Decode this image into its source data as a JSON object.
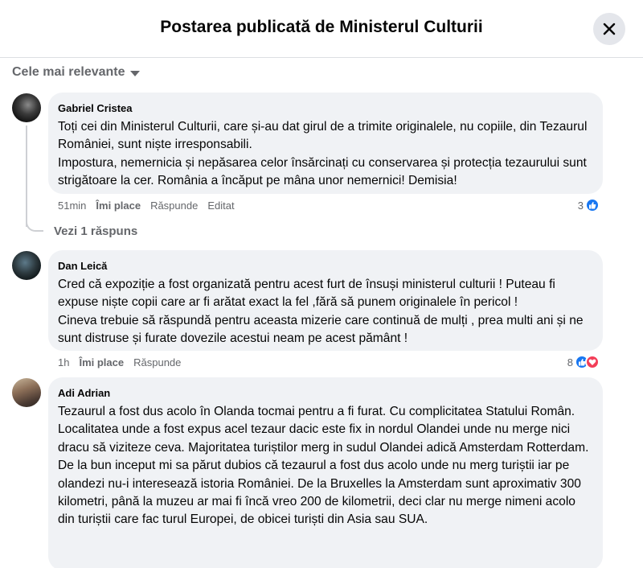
{
  "header": {
    "title": "Postarea publicată de Ministerul Culturii"
  },
  "sort": {
    "label": "Cele mai relevante"
  },
  "comments": [
    {
      "author": "Gabriel Cristea",
      "text": "Toți cei din Ministerul Culturii, care și-au dat girul de a trimite originalele, nu copiile, din Tezaurul României, sunt niște irresponsabili.\nImpostura, nemernicia și nepăsarea celor însărcinați cu conservarea și protecția tezaurului sunt strigătoare la cer. România a încăput pe mâna unor nemernici! Demisia!",
      "time": "51min",
      "like_label": "Îmi place",
      "reply_label": "Răspunde",
      "edited_label": "Editat",
      "reaction_count": "3",
      "replies_label": "Vezi 1 răspuns"
    },
    {
      "author": "Dan Leică",
      "text": "Cred că expoziție a fost organizată pentru acest furt de însuși ministerul culturii ! Puteau fi expuse niște copii care ar fi arătat exact la fel ,fără să punem originalele în pericol !\nCineva trebuie să răspundă pentru aceasta mizerie care continuă de mulți , prea multi ani și ne sunt distruse și furate dovezile acestui neam pe acest pământ !",
      "time": "1h",
      "like_label": "Îmi place",
      "reply_label": "Răspunde",
      "reaction_count": "8"
    },
    {
      "author": "Adi Adrian",
      "text": "Tezaurul a fost dus acolo în Olanda tocmai pentru a fi furat. Cu complicitatea Statului Român.\nLocalitatea unde a fost expus acel tezaur dacic este fix in nordul Olandei unde nu merge nici dracu să viziteze ceva. Majoritatea turiștilor merg in sudul Olandei adică Amsterdam Rotterdam. De la bun inceput mi sa părut dubios că tezaurul a fost dus acolo unde nu merg turiștii iar pe olandezi nu-i interesează istoria României. De la Bruxelles la Amsterdam sunt aproximativ 300 kilometri, până la muzeu ar mai fi încă vreo 200 de kilometrii, deci clar nu merge nimeni acolo din turiștii care fac turul Europei, de obicei turiști din Asia sau SUA."
    }
  ],
  "icons": {
    "close": "close-icon",
    "sort_caret": "caret-down-icon",
    "like": "like-icon",
    "love": "love-icon"
  },
  "colors": {
    "like": "#1877f2",
    "love": "#f33e58",
    "bubble": "#f0f2f5",
    "muted_text": "#65676b"
  }
}
